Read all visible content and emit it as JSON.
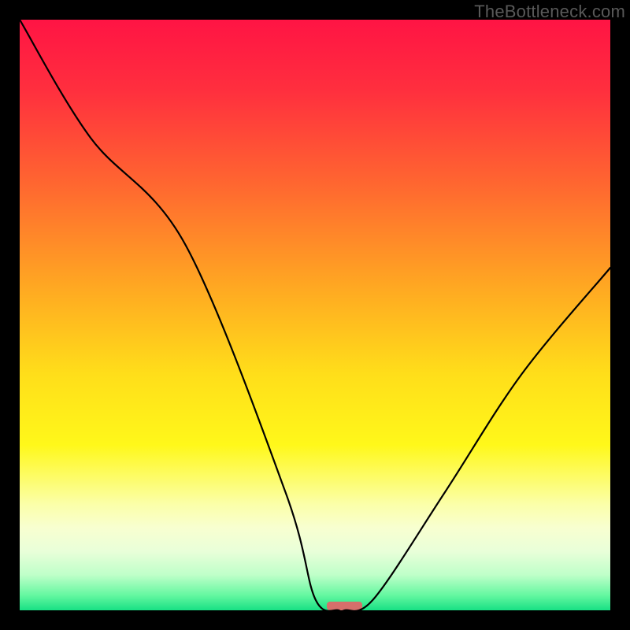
{
  "watermark": "TheBottleneck.com",
  "chart_data": {
    "type": "line",
    "title": "",
    "xlabel": "",
    "ylabel": "",
    "xlim": [
      0,
      100
    ],
    "ylim": [
      0,
      100
    ],
    "series": [
      {
        "name": "bottleneck-curve",
        "x": [
          0,
          12,
          28,
          45,
          50,
          54,
          55,
          60,
          72,
          85,
          100
        ],
        "values": [
          100,
          80,
          62,
          20,
          2,
          0,
          0,
          2,
          20,
          40,
          58
        ]
      }
    ],
    "marker": {
      "name": "optimum-range",
      "x_start": 52,
      "x_end": 58,
      "y": 0.8,
      "color": "#d66f6b"
    },
    "gradient_stops": [
      {
        "offset": 0.0,
        "color": "#ff1444"
      },
      {
        "offset": 0.12,
        "color": "#ff2f3e"
      },
      {
        "offset": 0.28,
        "color": "#ff6730"
      },
      {
        "offset": 0.45,
        "color": "#ffa722"
      },
      {
        "offset": 0.6,
        "color": "#ffde1a"
      },
      {
        "offset": 0.72,
        "color": "#fff81a"
      },
      {
        "offset": 0.82,
        "color": "#fbffa8"
      },
      {
        "offset": 0.86,
        "color": "#f8ffd0"
      },
      {
        "offset": 0.9,
        "color": "#e9ffd9"
      },
      {
        "offset": 0.94,
        "color": "#bfffc9"
      },
      {
        "offset": 0.975,
        "color": "#63f7a0"
      },
      {
        "offset": 1.0,
        "color": "#18e084"
      }
    ]
  }
}
